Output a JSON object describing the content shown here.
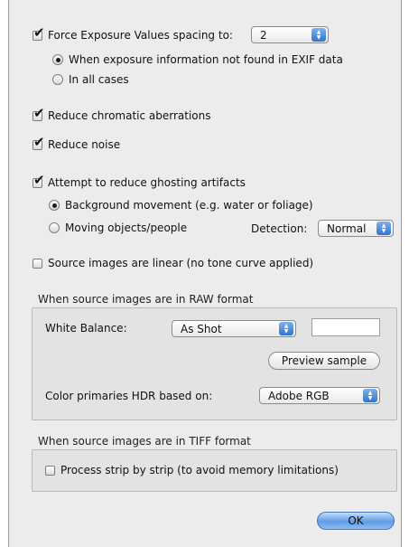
{
  "exposure": {
    "force_label": "Force Exposure Values spacing to:",
    "spacing_value": "2",
    "opt_not_found": "When exposure information not found in EXIF data",
    "opt_all_cases": "In all cases"
  },
  "options": {
    "chromatic": "Reduce chromatic aberrations",
    "noise": "Reduce noise",
    "ghosting": "Attempt to reduce ghosting artifacts",
    "bg_movement": "Background movement (e.g. water or foliage)",
    "moving_objects": "Moving objects/people",
    "detection_label": "Detection:",
    "detection_value": "Normal",
    "linear": "Source images are linear (no tone curve applied)"
  },
  "raw": {
    "title": "When source images are in RAW format",
    "white_balance_label": "White Balance:",
    "white_balance_value": "As Shot",
    "preview_button": "Preview sample",
    "color_primaries_label": "Color primaries HDR based on:",
    "color_primaries_value": "Adobe RGB"
  },
  "tiff": {
    "title": "When source images are in TIFF format",
    "strip_label": "Process strip by strip (to avoid memory limitations)"
  },
  "footer": {
    "ok_label": "OK"
  }
}
